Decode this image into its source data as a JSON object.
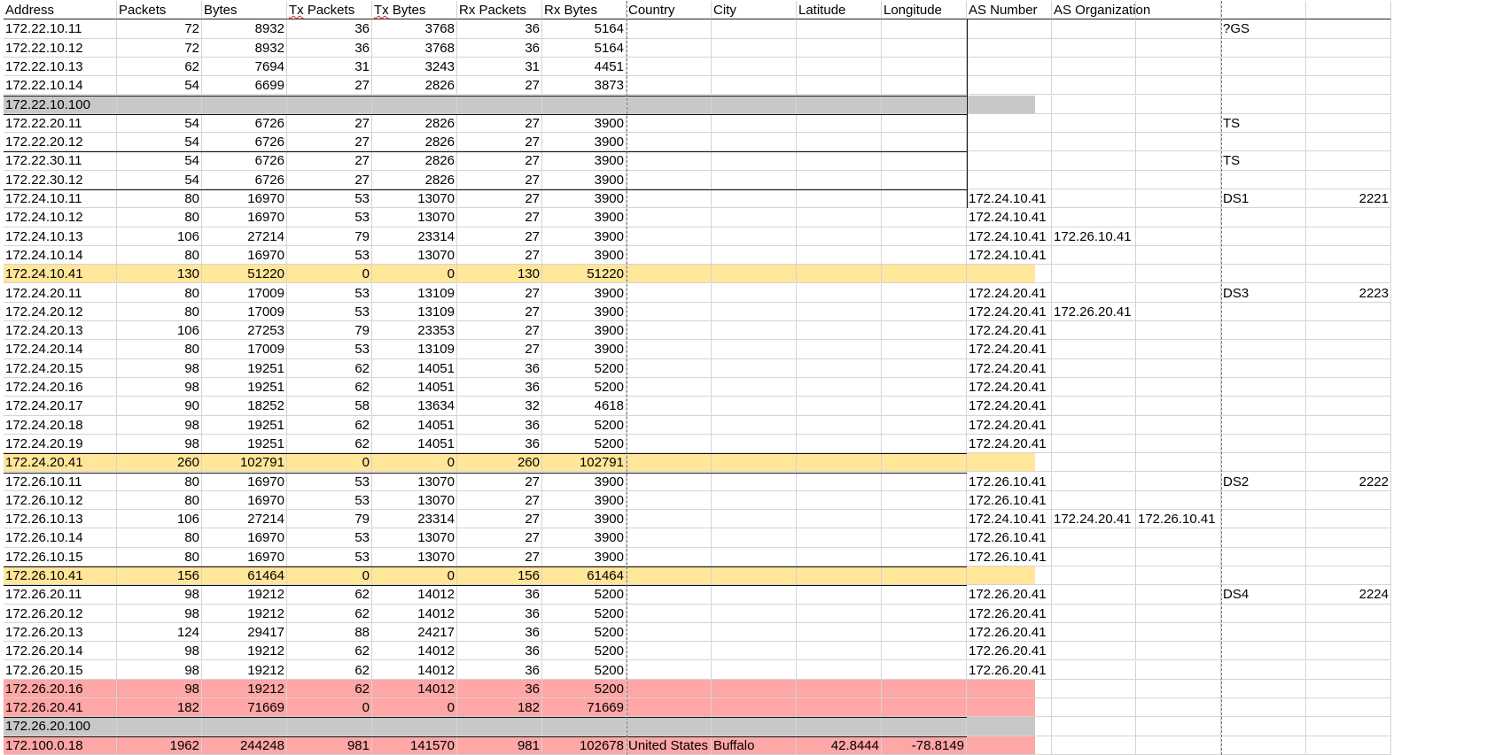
{
  "headers": [
    "Address",
    "Packets",
    "Bytes",
    "Tx Packets",
    "Tx Bytes",
    "Rx Packets",
    "Rx Bytes",
    "Country",
    "City",
    "Latitude",
    "Longitude",
    "AS Number",
    "AS Organization",
    "",
    "",
    ""
  ],
  "rows": [
    {
      "style": "",
      "cells": [
        "172.22.10.11",
        "72",
        "8932",
        "36",
        "3768",
        "36",
        "5164",
        "",
        "",
        "",
        "",
        "",
        "",
        "",
        "?GS",
        ""
      ]
    },
    {
      "style": "",
      "cells": [
        "172.22.10.12",
        "72",
        "8932",
        "36",
        "3768",
        "36",
        "5164",
        "",
        "",
        "",
        "",
        "",
        "",
        "",
        "",
        ""
      ]
    },
    {
      "style": "",
      "cells": [
        "172.22.10.13",
        "62",
        "7694",
        "31",
        "3243",
        "31",
        "4451",
        "",
        "",
        "",
        "",
        "",
        "",
        "",
        "",
        ""
      ]
    },
    {
      "style": "",
      "cells": [
        "172.22.10.14",
        "54",
        "6699",
        "27",
        "2826",
        "27",
        "3873",
        "",
        "",
        "",
        "",
        "",
        "",
        "",
        "",
        ""
      ]
    },
    {
      "style": "gray",
      "cells": [
        "172.22.10.100",
        "",
        "",
        "",
        "",
        "",
        "",
        "",
        "",
        "",
        "",
        "",
        "",
        "",
        "",
        ""
      ]
    },
    {
      "style": "",
      "cells": [
        "172.22.20.11",
        "54",
        "6726",
        "27",
        "2826",
        "27",
        "3900",
        "",
        "",
        "",
        "",
        "",
        "",
        "",
        "TS",
        ""
      ]
    },
    {
      "style": "",
      "cells": [
        "172.22.20.12",
        "54",
        "6726",
        "27",
        "2826",
        "27",
        "3900",
        "",
        "",
        "",
        "",
        "",
        "",
        "",
        "",
        ""
      ]
    },
    {
      "style": "",
      "cells": [
        "172.22.30.11",
        "54",
        "6726",
        "27",
        "2826",
        "27",
        "3900",
        "",
        "",
        "",
        "",
        "",
        "",
        "",
        "TS",
        ""
      ]
    },
    {
      "style": "",
      "cells": [
        "172.22.30.12",
        "54",
        "6726",
        "27",
        "2826",
        "27",
        "3900",
        "",
        "",
        "",
        "",
        "",
        "",
        "",
        "",
        ""
      ]
    },
    {
      "style": "",
      "cells": [
        "172.24.10.11",
        "80",
        "16970",
        "53",
        "13070",
        "27",
        "3900",
        "",
        "",
        "",
        "",
        "172.24.10.41",
        "",
        "",
        "DS1",
        "2221"
      ]
    },
    {
      "style": "",
      "cells": [
        "172.24.10.12",
        "80",
        "16970",
        "53",
        "13070",
        "27",
        "3900",
        "",
        "",
        "",
        "",
        "172.24.10.41",
        "",
        "",
        "",
        ""
      ]
    },
    {
      "style": "",
      "cells": [
        "172.24.10.13",
        "106",
        "27214",
        "79",
        "23314",
        "27",
        "3900",
        "",
        "",
        "",
        "",
        "172.24.10.41",
        "172.26.10.41",
        "",
        "",
        ""
      ]
    },
    {
      "style": "",
      "cells": [
        "172.24.10.14",
        "80",
        "16970",
        "53",
        "13070",
        "27",
        "3900",
        "",
        "",
        "",
        "",
        "172.24.10.41",
        "",
        "",
        "",
        ""
      ]
    },
    {
      "style": "yellow",
      "cells": [
        "172.24.10.41",
        "130",
        "51220",
        "0",
        "0",
        "130",
        "51220",
        "",
        "",
        "",
        "",
        "",
        "",
        "",
        "",
        ""
      ]
    },
    {
      "style": "",
      "cells": [
        "172.24.20.11",
        "80",
        "17009",
        "53",
        "13109",
        "27",
        "3900",
        "",
        "",
        "",
        "",
        "172.24.20.41",
        "",
        "",
        "DS3",
        "2223"
      ]
    },
    {
      "style": "",
      "cells": [
        "172.24.20.12",
        "80",
        "17009",
        "53",
        "13109",
        "27",
        "3900",
        "",
        "",
        "",
        "",
        "172.24.20.41",
        "172.26.20.41",
        "",
        "",
        ""
      ]
    },
    {
      "style": "",
      "cells": [
        "172.24.20.13",
        "106",
        "27253",
        "79",
        "23353",
        "27",
        "3900",
        "",
        "",
        "",
        "",
        "172.24.20.41",
        "",
        "",
        "",
        ""
      ]
    },
    {
      "style": "",
      "cells": [
        "172.24.20.14",
        "80",
        "17009",
        "53",
        "13109",
        "27",
        "3900",
        "",
        "",
        "",
        "",
        "172.24.20.41",
        "",
        "",
        "",
        ""
      ]
    },
    {
      "style": "",
      "cells": [
        "172.24.20.15",
        "98",
        "19251",
        "62",
        "14051",
        "36",
        "5200",
        "",
        "",
        "",
        "",
        "172.24.20.41",
        "",
        "",
        "",
        ""
      ]
    },
    {
      "style": "",
      "cells": [
        "172.24.20.16",
        "98",
        "19251",
        "62",
        "14051",
        "36",
        "5200",
        "",
        "",
        "",
        "",
        "172.24.20.41",
        "",
        "",
        "",
        ""
      ]
    },
    {
      "style": "",
      "cells": [
        "172.24.20.17",
        "90",
        "18252",
        "58",
        "13634",
        "32",
        "4618",
        "",
        "",
        "",
        "",
        "172.24.20.41",
        "",
        "",
        "",
        ""
      ]
    },
    {
      "style": "",
      "cells": [
        "172.24.20.18",
        "98",
        "19251",
        "62",
        "14051",
        "36",
        "5200",
        "",
        "",
        "",
        "",
        "172.24.20.41",
        "",
        "",
        "",
        ""
      ]
    },
    {
      "style": "",
      "cells": [
        "172.24.20.19",
        "98",
        "19251",
        "62",
        "14051",
        "36",
        "5200",
        "",
        "",
        "",
        "",
        "172.24.20.41",
        "",
        "",
        "",
        ""
      ]
    },
    {
      "style": "yellow",
      "cells": [
        "172.24.20.41",
        "260",
        "102791",
        "0",
        "0",
        "260",
        "102791",
        "",
        "",
        "",
        "",
        "",
        "",
        "",
        "",
        ""
      ]
    },
    {
      "style": "",
      "cells": [
        "172.26.10.11",
        "80",
        "16970",
        "53",
        "13070",
        "27",
        "3900",
        "",
        "",
        "",
        "",
        "172.26.10.41",
        "",
        "",
        "DS2",
        "2222"
      ]
    },
    {
      "style": "",
      "cells": [
        "172.26.10.12",
        "80",
        "16970",
        "53",
        "13070",
        "27",
        "3900",
        "",
        "",
        "",
        "",
        "172.26.10.41",
        "",
        "",
        "",
        ""
      ]
    },
    {
      "style": "",
      "cells": [
        "172.26.10.13",
        "106",
        "27214",
        "79",
        "23314",
        "27",
        "3900",
        "",
        "",
        "",
        "",
        "172.24.10.41",
        "172.24.20.41",
        "172.26.10.41",
        "",
        ""
      ]
    },
    {
      "style": "",
      "cells": [
        "172.26.10.14",
        "80",
        "16970",
        "53",
        "13070",
        "27",
        "3900",
        "",
        "",
        "",
        "",
        "172.26.10.41",
        "",
        "",
        "",
        ""
      ]
    },
    {
      "style": "",
      "cells": [
        "172.26.10.15",
        "80",
        "16970",
        "53",
        "13070",
        "27",
        "3900",
        "",
        "",
        "",
        "",
        "172.26.10.41",
        "",
        "",
        "",
        ""
      ]
    },
    {
      "style": "yellow",
      "cells": [
        "172.26.10.41",
        "156",
        "61464",
        "0",
        "0",
        "156",
        "61464",
        "",
        "",
        "",
        "",
        "",
        "",
        "",
        "",
        ""
      ]
    },
    {
      "style": "",
      "cells": [
        "172.26.20.11",
        "98",
        "19212",
        "62",
        "14012",
        "36",
        "5200",
        "",
        "",
        "",
        "",
        "172.26.20.41",
        "",
        "",
        "DS4",
        "2224"
      ]
    },
    {
      "style": "",
      "cells": [
        "172.26.20.12",
        "98",
        "19212",
        "62",
        "14012",
        "36",
        "5200",
        "",
        "",
        "",
        "",
        "172.26.20.41",
        "",
        "",
        "",
        ""
      ]
    },
    {
      "style": "",
      "cells": [
        "172.26.20.13",
        "124",
        "29417",
        "88",
        "24217",
        "36",
        "5200",
        "",
        "",
        "",
        "",
        "172.26.20.41",
        "",
        "",
        "",
        ""
      ]
    },
    {
      "style": "",
      "cells": [
        "172.26.20.14",
        "98",
        "19212",
        "62",
        "14012",
        "36",
        "5200",
        "",
        "",
        "",
        "",
        "172.26.20.41",
        "",
        "",
        "",
        ""
      ]
    },
    {
      "style": "",
      "cells": [
        "172.26.20.15",
        "98",
        "19212",
        "62",
        "14012",
        "36",
        "5200",
        "",
        "",
        "",
        "",
        "172.26.20.41",
        "",
        "",
        "",
        ""
      ]
    },
    {
      "style": "red",
      "cells": [
        "172.26.20.16",
        "98",
        "19212",
        "62",
        "14012",
        "36",
        "5200",
        "",
        "",
        "",
        "",
        "",
        "",
        "",
        "",
        ""
      ]
    },
    {
      "style": "red",
      "cells": [
        "172.26.20.41",
        "182",
        "71669",
        "0",
        "0",
        "182",
        "71669",
        "",
        "",
        "",
        "",
        "",
        "",
        "",
        "",
        ""
      ]
    },
    {
      "style": "gray",
      "cells": [
        "172.26.20.100",
        "",
        "",
        "",
        "",
        "",
        "",
        "",
        "",
        "",
        "",
        "",
        "",
        "",
        "",
        ""
      ]
    },
    {
      "style": "red",
      "cells": [
        "172.100.0.18",
        "1962",
        "244248",
        "981",
        "141570",
        "981",
        "102678",
        "United States",
        "Buffalo",
        "42.8444",
        "-78.8149",
        "",
        "",
        "",
        "",
        ""
      ]
    }
  ],
  "colors": {
    "yellow_highlight": "#ffe699",
    "gray_highlight": "#c8c8c8",
    "red_highlight": "#ffa6a6",
    "gridline": "#d4d4d4"
  }
}
